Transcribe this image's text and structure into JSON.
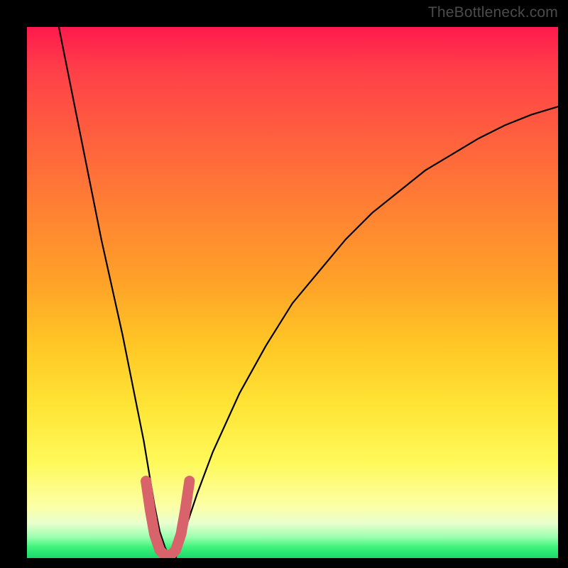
{
  "watermark": "TheBottleneck.com",
  "chart_data": {
    "type": "line",
    "title": "",
    "xlabel": "",
    "ylabel": "",
    "xlim": [
      0,
      100
    ],
    "ylim": [
      0,
      100
    ],
    "grid": false,
    "legend": false,
    "background_gradient": {
      "top": "#ff1a4d",
      "bottom": "#18d96c",
      "note": "vertical red→orange→yellow→green gradient; green at bottom means optimal"
    },
    "series": [
      {
        "name": "bottleneck-curve",
        "color": "#000000",
        "x": [
          6,
          8,
          10,
          12,
          14,
          16,
          18,
          20,
          21,
          22,
          23,
          24,
          25,
          26,
          27,
          28,
          29,
          30,
          32,
          35,
          40,
          45,
          50,
          55,
          60,
          65,
          70,
          75,
          80,
          85,
          90,
          95,
          100
        ],
        "y": [
          100,
          90,
          80,
          70,
          60,
          51,
          42,
          32,
          27,
          22,
          16,
          10,
          5,
          2,
          0,
          0,
          3,
          6,
          12,
          20,
          31,
          40,
          48,
          54,
          60,
          65,
          69,
          73,
          76,
          79,
          81.5,
          83.5,
          85
        ]
      },
      {
        "name": "optimal-zone-marker",
        "color": "#d9636b",
        "display": "thick rounded U overlay near minimum",
        "x": [
          22.4,
          23.2,
          24.0,
          25.0,
          26.0,
          27.0,
          28.0,
          29.0,
          29.8,
          30.6
        ],
        "y": [
          14.5,
          9.0,
          4.5,
          1.5,
          0.5,
          0.5,
          1.5,
          4.5,
          9.0,
          14.5
        ]
      }
    ]
  }
}
